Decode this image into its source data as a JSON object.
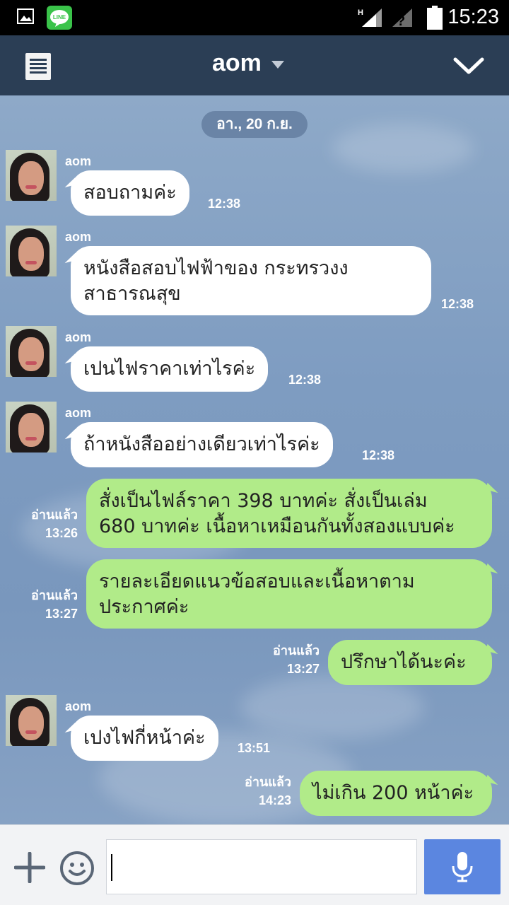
{
  "status_bar": {
    "time": "15:23",
    "notification_icons": [
      "image-icon",
      "line-app-icon"
    ],
    "system_icons": [
      "signal-h-icon",
      "no-sim-icon",
      "battery-icon"
    ]
  },
  "header": {
    "title": "aom",
    "colors": {
      "background": "#2b3e55",
      "text": "#ffffff"
    }
  },
  "chat": {
    "date_separator": "อา., 20 ก.ย.",
    "messages": [
      {
        "direction": "incoming",
        "sender": "aom",
        "lines": [
          "สอบถามค่ะ"
        ],
        "time": "12:38"
      },
      {
        "direction": "incoming",
        "sender": "aom",
        "lines": [
          "หนังสือสอบไฟฟ้าของ กระทรวงง",
          "สาธารณสุข"
        ],
        "time": "12:38"
      },
      {
        "direction": "incoming",
        "sender": "aom",
        "lines": [
          "เปนไฟราคาเท่าไรค่ะ"
        ],
        "time": "12:38"
      },
      {
        "direction": "incoming",
        "sender": "aom",
        "lines": [
          "ถ้าหนังสืออย่างเดียวเท่าไรค่ะ"
        ],
        "time": "12:38"
      },
      {
        "direction": "outgoing",
        "read": "อ่านแล้ว",
        "time": "13:26",
        "lines": [
          "สั่งเป็นไฟล์ราคา 398 บาทค่ะ สั่งเป็นเล่ม",
          "680 บาทค่ะ เนื้อหาเหมือนกันทั้งสองแบบค่ะ"
        ]
      },
      {
        "direction": "outgoing",
        "read": "อ่านแล้ว",
        "time": "13:27",
        "lines": [
          "รายละเอียดแนวข้อสอบและเนื้อหาตาม",
          "ประกาศค่ะ"
        ]
      },
      {
        "direction": "outgoing",
        "read": "อ่านแล้ว",
        "time": "13:27",
        "lines": [
          "ปรึกษาได้นะค่ะ"
        ]
      },
      {
        "direction": "incoming",
        "sender": "aom",
        "lines": [
          "เปงไฟกี่หน้าค่ะ"
        ],
        "time": "13:51"
      },
      {
        "direction": "outgoing",
        "read": "อ่านแล้ว",
        "time": "14:23",
        "lines": [
          "ไม่เกิน 200 หน้าค่ะ"
        ]
      }
    ],
    "colors": {
      "incoming_bubble": "#ffffff",
      "outgoing_bubble": "#b1eb89",
      "date_pill": "#6a84a6"
    }
  },
  "input_bar": {
    "message_value": "",
    "icons": [
      "plus-icon",
      "emoji-icon",
      "microphone-icon"
    ],
    "colors": {
      "mic_button": "#5b86e0"
    }
  }
}
